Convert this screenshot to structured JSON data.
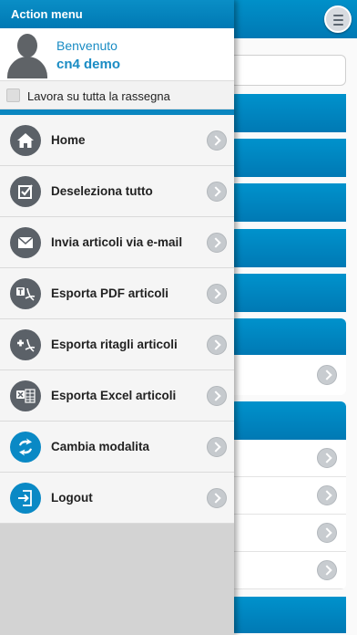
{
  "drawer": {
    "title": "Action menu",
    "user": {
      "greeting": "Benvenuto",
      "name": "cn4 demo"
    },
    "check_label": "Lavora su tutta la rassegna",
    "items": [
      {
        "label": "Home",
        "icon": "home-icon"
      },
      {
        "label": "Deseleziona tutto",
        "icon": "checkbox-icon"
      },
      {
        "label": "Invia articoli via e-mail",
        "icon": "mail-icon"
      },
      {
        "label": "Esporta PDF articoli",
        "icon": "pdf-icon"
      },
      {
        "label": "Esporta ritagli articoli",
        "icon": "clip-icon"
      },
      {
        "label": "Esporta Excel articoli",
        "icon": "excel-icon"
      },
      {
        "label": "Cambia modalita",
        "icon": "swap-icon"
      },
      {
        "label": "Logout",
        "icon": "logout-icon"
      }
    ]
  },
  "colors": {
    "accent": "#0a89c5",
    "icon_gray": "#5b6168"
  }
}
